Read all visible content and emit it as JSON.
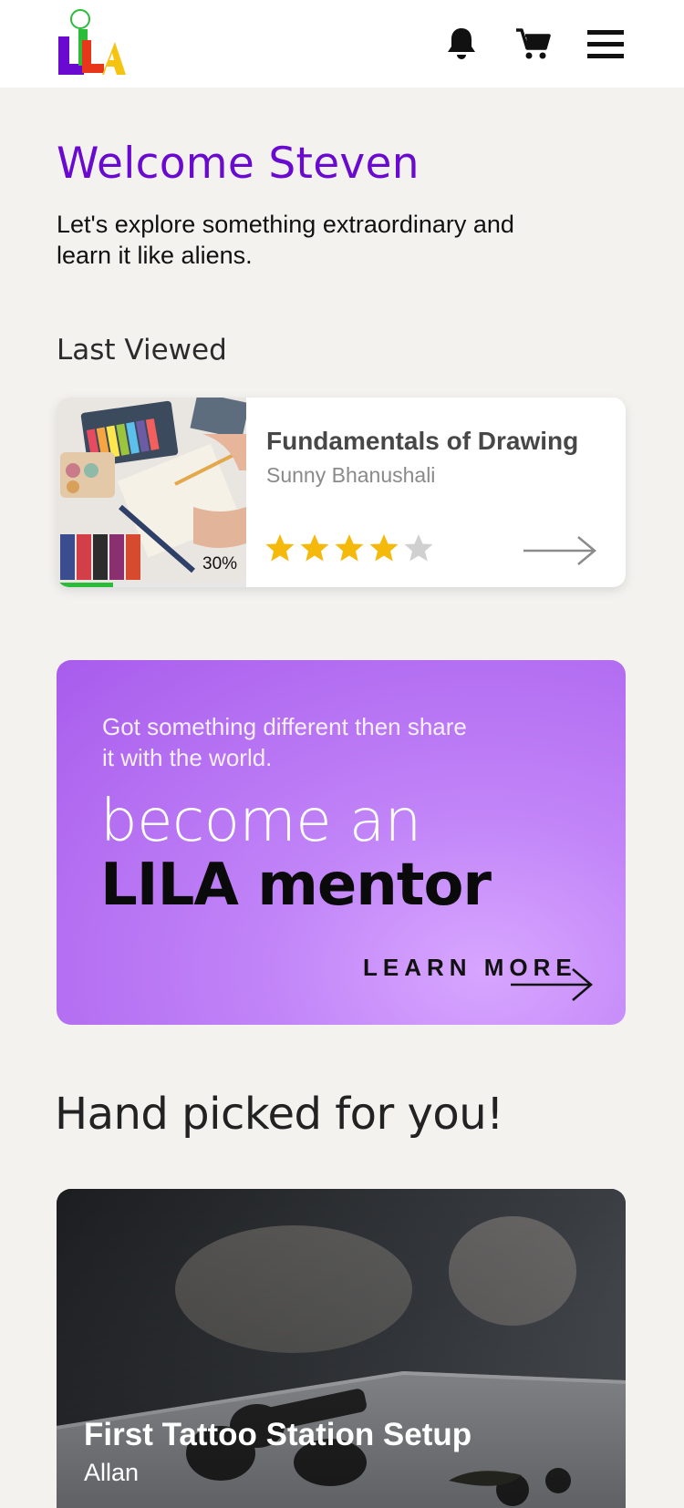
{
  "header": {
    "logo_text": "LILA",
    "notifications_icon": "bell-icon",
    "cart_icon": "cart-icon",
    "menu_icon": "hamburger-menu-icon"
  },
  "welcome": {
    "title": "Welcome Steven",
    "subtitle": "Let's explore something extraordinary and learn it like aliens."
  },
  "last_viewed": {
    "section_label": "Last Viewed",
    "course": {
      "title": "Fundamentals of Drawing",
      "author": "Sunny Bhanushali",
      "progress_label": "30%",
      "progress": 0.3,
      "rating": 4,
      "rating_max": 5
    }
  },
  "mentor_banner": {
    "subtitle": "Got something different then share it with the world.",
    "line1": "become an",
    "line2": "LILA mentor",
    "cta_label": "LEARN MORE"
  },
  "hand_picked": {
    "section_label": "Hand picked for you!",
    "course": {
      "title": "First Tattoo Station Setup",
      "author": "Allan"
    }
  },
  "colors": {
    "brand_purple": "#6a0ad0",
    "progress_green": "#2bbd3a",
    "star_gold": "#f5b90c",
    "background": "#f3f2ef"
  }
}
